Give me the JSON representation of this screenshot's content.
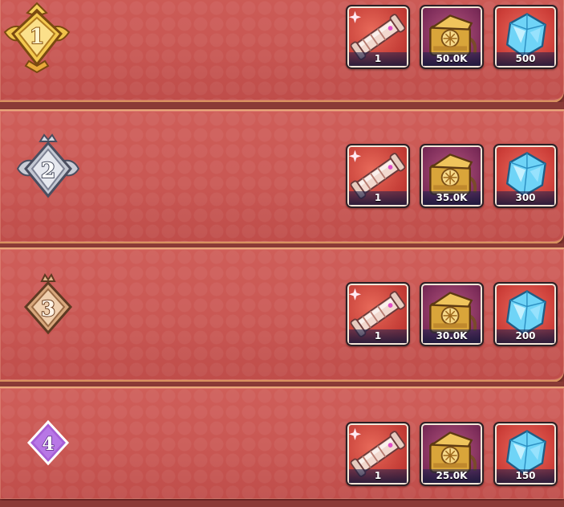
{
  "ranks": [
    {
      "rank": "1",
      "tier": "gold",
      "rewards": [
        {
          "icon": "scroll-icon",
          "quantity": "1"
        },
        {
          "icon": "treasure-chest-icon",
          "quantity": "50.0K"
        },
        {
          "icon": "diamond-gem-icon",
          "quantity": "500"
        }
      ]
    },
    {
      "rank": "2",
      "tier": "silver",
      "rewards": [
        {
          "icon": "scroll-icon",
          "quantity": "1"
        },
        {
          "icon": "treasure-chest-icon",
          "quantity": "35.0K"
        },
        {
          "icon": "diamond-gem-icon",
          "quantity": "300"
        }
      ]
    },
    {
      "rank": "3",
      "tier": "bronze",
      "rewards": [
        {
          "icon": "scroll-icon",
          "quantity": "1"
        },
        {
          "icon": "treasure-chest-icon",
          "quantity": "30.0K"
        },
        {
          "icon": "diamond-gem-icon",
          "quantity": "200"
        }
      ]
    },
    {
      "rank": "4",
      "tier": "purple",
      "rewards": [
        {
          "icon": "scroll-icon",
          "quantity": "1"
        },
        {
          "icon": "treasure-chest-icon",
          "quantity": "25.0K"
        },
        {
          "icon": "diamond-gem-icon",
          "quantity": "150"
        }
      ]
    }
  ],
  "colors": {
    "row_background": "#cf5e59",
    "row_border": "#e8a67a",
    "gold": "#f0c24a",
    "silver": "#c9ccd6",
    "bronze": "#d8a77c",
    "purple": "#a65fd6"
  }
}
